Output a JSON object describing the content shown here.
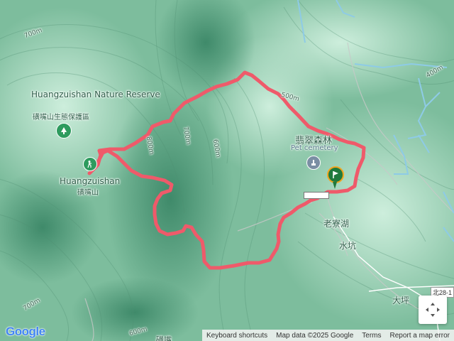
{
  "map": {
    "pois": [
      {
        "id": "reserve",
        "name_en": "Huangzuishan Nature Reserve",
        "name_zh": "磺嘴山生態保護區"
      },
      {
        "id": "peak",
        "name_en": "Huangzuishan",
        "name_zh": "磺嘴山"
      },
      {
        "id": "pet",
        "name_zh": "翡翠森林",
        "name_en": "Pet cemetery"
      }
    ],
    "place_labels": [
      "老寮湖",
      "水坑",
      "大坪"
    ],
    "contour_labels": [
      "700m",
      "800m",
      "700m",
      "600m",
      "500m",
      "400m",
      "700m",
      "600m"
    ],
    "road_label": "北28-1",
    "partial_label": "磺嘴",
    "colors": {
      "route": "#ef5a6a",
      "water": "#8ecbe6",
      "terrain_dark": "#5ea184",
      "terrain_light": "#bfe3cf"
    }
  },
  "attribution": {
    "logo": "Google",
    "shortcuts": "Keyboard shortcuts",
    "data": "Map data ©2025 Google",
    "terms": "Terms",
    "report": "Report a map error"
  },
  "controls": {
    "fullscreen_icon": "fullscreen-icon",
    "start_marker_icon": "flag-marker-icon"
  }
}
